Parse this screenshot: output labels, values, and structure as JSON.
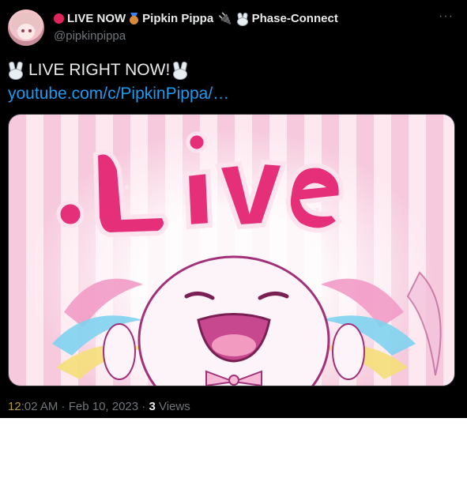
{
  "author": {
    "display_name": "LIVE NOW",
    "display_name_2": "Pipkin Pippa",
    "display_name_3": "Phase-Connect",
    "handle": "@pipkinpippa",
    "avatar_icon": "anime-girl-avatar"
  },
  "more_label": "···",
  "tweet": {
    "text": "LIVE RIGHT NOW!",
    "link": "youtube.com/c/PipkinPippa/…"
  },
  "media": {
    "title_text": ".Live",
    "image_icon": "axolotl-live-illustration"
  },
  "meta": {
    "time_hl": "12",
    "time_rest": ":02 AM · Feb 10, 2023 · ",
    "views_count": "3",
    "views_label": " Views"
  },
  "colors": {
    "background": "#000000",
    "link": "#1d9bf0",
    "muted": "#71767b",
    "text": "#e7e9ea",
    "live_dot": "#e0245e"
  }
}
